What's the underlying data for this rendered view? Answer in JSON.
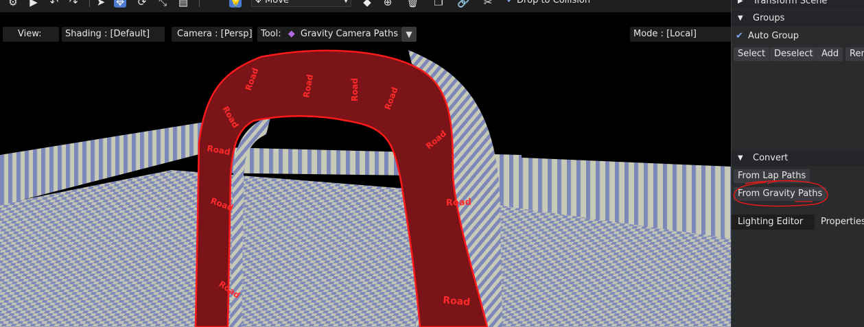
{
  "toolbar": {
    "move_label": "Move",
    "drop_to_collision_label": "Drop to Collision",
    "drop_to_collision_checked": true
  },
  "viewport_header": {
    "view_label": "View:",
    "shading_label": "Shading : [Default]",
    "camera_label": "Camera : [Persp]",
    "tool_prefix": "Tool:",
    "tool_value": "Gravity Camera Paths",
    "mode_label": "Mode : [Local]"
  },
  "scene": {
    "road_text": "Road",
    "road_color": "#7a1418",
    "road_outline": "#ff1a1a",
    "wall_light": "#c8cab8",
    "wall_blue": "#7e88b8"
  },
  "panel": {
    "transform_scene_label": "Transform Scene",
    "groups": {
      "header": "Groups",
      "auto_group_label": "Auto Group",
      "auto_group_checked": true,
      "select_label": "Select",
      "deselect_label": "Deselect",
      "add_label": "Add",
      "remove_label": "Ren"
    },
    "convert": {
      "header": "Convert",
      "from_lap_paths_label": "From Lap Paths",
      "from_gravity_paths_label": "From Gravity Paths"
    },
    "tabs": {
      "lighting_editor_label": "Lighting Editor",
      "properties_label": "Properties"
    }
  },
  "colors": {
    "accent_blue": "#4a7bd0",
    "annotation_red": "#e01b1b",
    "tool_icon_purple": "#b06ae8"
  }
}
